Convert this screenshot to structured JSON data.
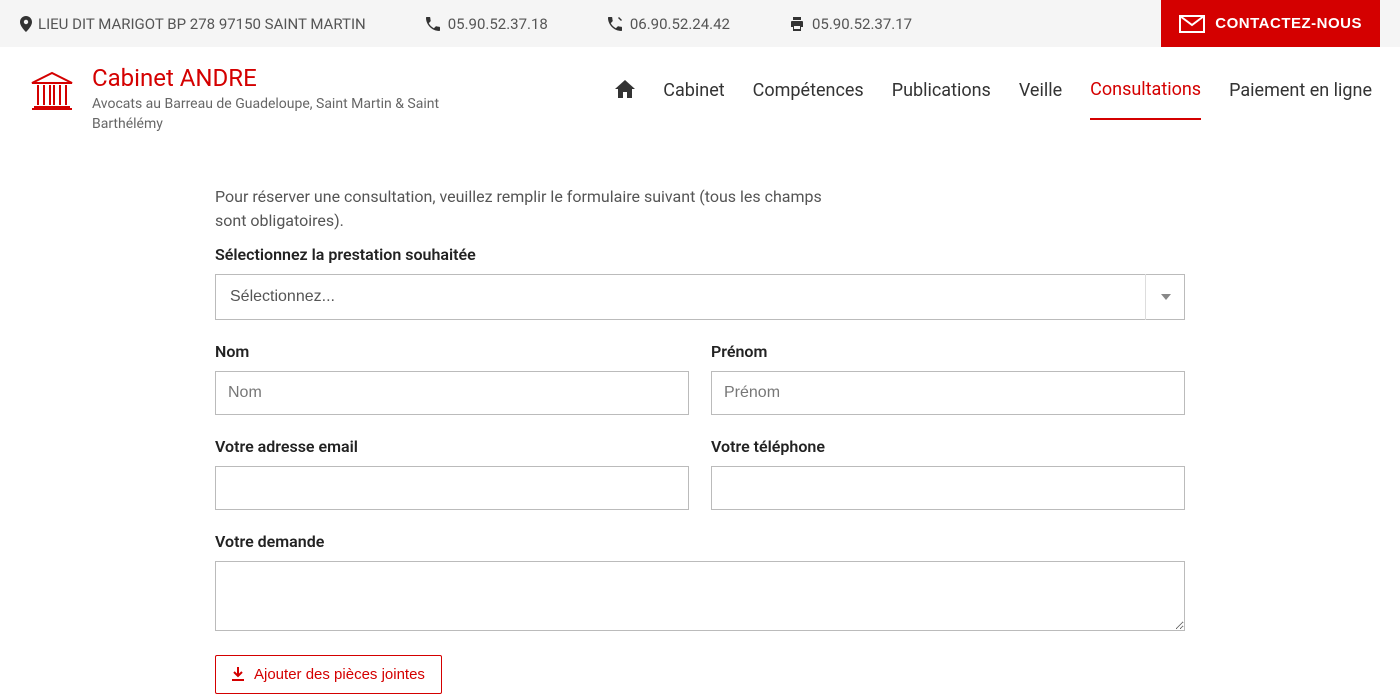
{
  "topbar": {
    "address": "LIEU DIT MARIGOT BP 278 97150 SAINT MARTIN",
    "phone1": "05.90.52.37.18",
    "phone2": "06.90.52.24.42",
    "fax": "05.90.52.37.17",
    "contact_label": "CONTACTEZ-NOUS"
  },
  "brand": {
    "name": "Cabinet ANDRE",
    "subtitle": "Avocats au Barreau de Guadeloupe, Saint Martin & Saint Barthélémy"
  },
  "nav": {
    "items": [
      "Cabinet",
      "Compétences",
      "Publications",
      "Veille",
      "Consultations",
      "Paiement en ligne"
    ],
    "active": "Consultations"
  },
  "form": {
    "intro": "Pour réserver une consultation, veuillez remplir le formulaire suivant (tous les champs sont obligatoires).",
    "prestation_label": "Sélectionnez la prestation souhaitée",
    "select_placeholder": "Sélectionnez...",
    "nom_label": "Nom",
    "nom_placeholder": "Nom",
    "prenom_label": "Prénom",
    "prenom_placeholder": "Prénom",
    "email_label": "Votre adresse email",
    "phone_label": "Votre téléphone",
    "demande_label": "Votre demande",
    "attach_label": "Ajouter des pièces jointes"
  },
  "colors": {
    "accent": "#d40000"
  }
}
